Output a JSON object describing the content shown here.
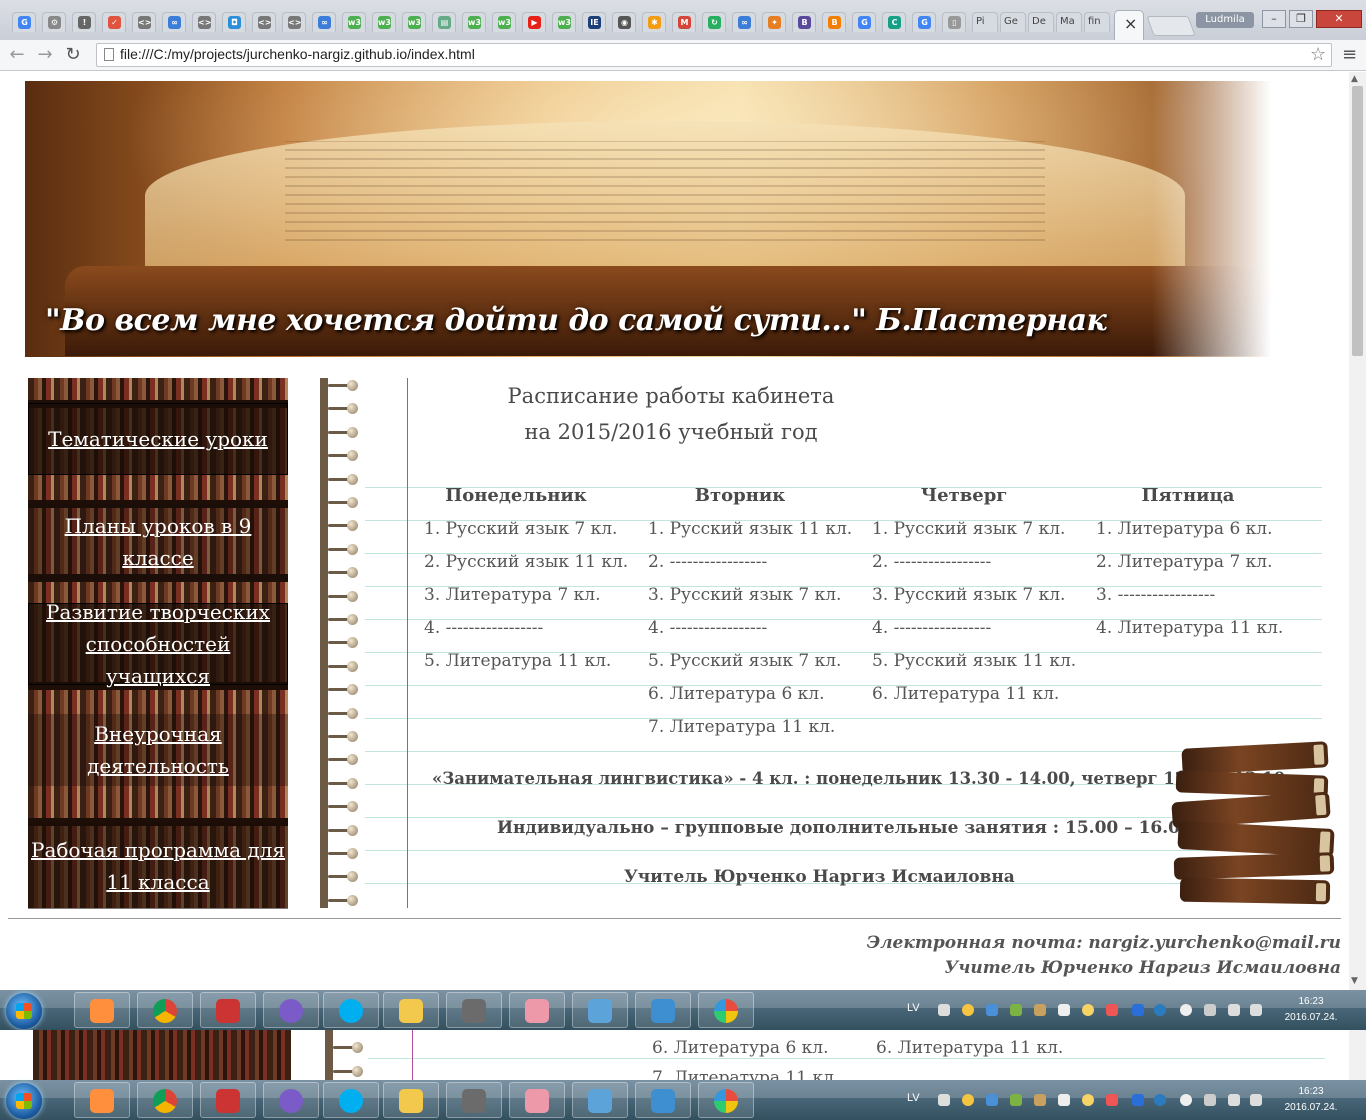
{
  "browser": {
    "url": "file:///C:/my/projects/jurchenko-nargiz.github.io/index.html",
    "profile_name": "Ludmila",
    "tab_labels": [
      "Pi",
      "Ge",
      "De",
      "Ma",
      "fin"
    ],
    "window_buttons": {
      "minimize": "–",
      "maximize": "❐",
      "close": "✕"
    },
    "close_tab_glyph": "×"
  },
  "header": {
    "quote": "\"Во всем мне хочется дойти до самой сути...\" Б.Пастернак"
  },
  "sidebar": {
    "items": [
      {
        "label": "Тематические уроки"
      },
      {
        "label": "Планы уроков в 9 классе"
      },
      {
        "label": "Развитие творческих способностей учащихся"
      },
      {
        "label": "Внеурочная деятельность"
      },
      {
        "label": "Рабочая программа для 11 класса"
      }
    ]
  },
  "schedule": {
    "title_line1": "Расписание работы кабинета",
    "title_line2": "на 2015/2016 учебный год",
    "days": [
      {
        "name": "Понедельник",
        "lessons": [
          "1.  Русский язык 7 кл.",
          "2.  Русский язык 11 кл.",
          "3.  Литература    7 кл.",
          "4. -----------------",
          "5.  Литература    11 кл."
        ]
      },
      {
        "name": "Вторник",
        "lessons": [
          "1.  Русский язык 11 кл.",
          "2.  -----------------",
          "3.  Русский язык 7 кл.",
          "4. -----------------",
          "5.  Русский язык 7 кл.",
          "6. Литература    6 кл.",
          "7. Литература    11 кл."
        ]
      },
      {
        "name": "Четверг",
        "lessons": [
          "1.  Русский язык 7 кл.",
          "2.  -----------------",
          "3.  Русский язык 7 кл.",
          "4. -----------------",
          "5.  Русский язык 11 кл.",
          "6. Литература    11 кл."
        ]
      },
      {
        "name": "Пятница",
        "lessons": [
          "1.  Литература 6 кл.",
          "2.  Литература 7 кл.",
          "3.  -----------------",
          "4. Литература 11 кл."
        ]
      }
    ],
    "note_linguistics": "«Занимательная лингвистика» - 4 кл. : понедельник 13.30 - 14.00, четверг 12.40 - 13.10",
    "note_individual": "Индивидуально – групповые дополнительные занятия : 15.00 – 16.00",
    "teacher": "Учитель Юрченко Наргиз Исмаиловна"
  },
  "footer": {
    "email_line": "Электронная почта: nargiz.yurchenko@mail.ru",
    "teacher_line": "Учитель Юрченко Наргиз Исмаиловна"
  },
  "taskbar": {
    "language": "LV",
    "time": "16:23",
    "date": "2016.07.24."
  },
  "leftover": {
    "tuesday_line": "6. Литература    6 кл.",
    "thursday_line": "6. Литература    11 кл.",
    "tuesday_line_7": "7. Литература    11 кл."
  }
}
